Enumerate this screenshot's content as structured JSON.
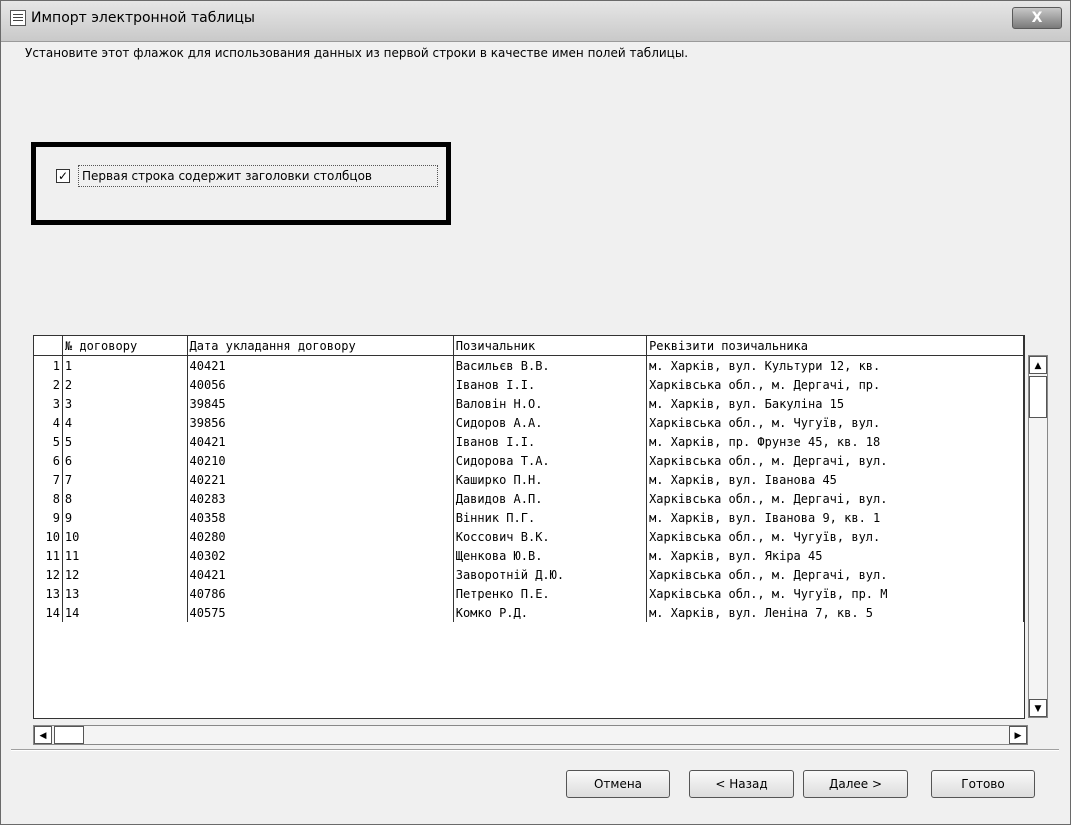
{
  "window": {
    "title": "Импорт электронной таблицы",
    "close_label": "X"
  },
  "hint": "Установите этот флажок для использования данных из первой строки в качестве имен полей таблицы.",
  "checkbox": {
    "label": "Первая строка содержит заголовки столбцов",
    "checked": true,
    "mark": "✓"
  },
  "table": {
    "columns": [
      "№ договору",
      "Дата укладання договору",
      "Позичальник",
      "Реквізити позичальника"
    ],
    "rows": [
      {
        "n": "1",
        "c": [
          "1",
          "40421",
          "Васильєв В.В.",
          "м. Харків, вул. Культури 12, кв."
        ]
      },
      {
        "n": "2",
        "c": [
          "2",
          "40056",
          "Іванов І.І.",
          "Харківська обл., м. Дергачі, пр."
        ]
      },
      {
        "n": "3",
        "c": [
          "3",
          "39845",
          "Валовін Н.О.",
          "м. Харків, вул. Бакуліна 15"
        ]
      },
      {
        "n": "4",
        "c": [
          "4",
          "39856",
          "Сидоров А.А.",
          "Харківська обл., м. Чугуїв, вул."
        ]
      },
      {
        "n": "5",
        "c": [
          "5",
          "40421",
          "Іванов І.І.",
          "м. Харків, пр. Фрунзе 45, кв. 18"
        ]
      },
      {
        "n": "6",
        "c": [
          "6",
          "40210",
          "Сидорова Т.А.",
          "Харківська обл., м. Дергачі, вул."
        ]
      },
      {
        "n": "7",
        "c": [
          "7",
          "40221",
          "Каширко П.Н.",
          "м. Харків, вул. Іванова 45"
        ]
      },
      {
        "n": "8",
        "c": [
          "8",
          "40283",
          "Давидов А.П.",
          "Харківська обл., м. Дергачі, вул."
        ]
      },
      {
        "n": "9",
        "c": [
          "9",
          "40358",
          "Вінник П.Г.",
          "м. Харків, вул. Іванова 9, кв. 1"
        ]
      },
      {
        "n": "10",
        "c": [
          "10",
          "40280",
          "Коссович В.К.",
          "Харківська обл., м. Чугуїв, вул."
        ]
      },
      {
        "n": "11",
        "c": [
          "11",
          "40302",
          "Щенкова Ю.В.",
          "м. Харків, вул. Якіра 45"
        ]
      },
      {
        "n": "12",
        "c": [
          "12",
          "40421",
          "Заворотній Д.Ю.",
          "Харківська обл., м. Дергачі, вул."
        ]
      },
      {
        "n": "13",
        "c": [
          "13",
          "40786",
          "Петренко П.Е.",
          "Харківська обл., м. Чугуїв, пр. М"
        ]
      },
      {
        "n": "14",
        "c": [
          "14",
          "40575",
          "Комко Р.Д.",
          "м. Харків, вул. Леніна 7, кв. 5"
        ]
      }
    ]
  },
  "buttons": {
    "cancel": "Отмена",
    "back": "< Назад",
    "next": "Далее >",
    "finish": "Готово"
  },
  "scroll": {
    "up": "▲",
    "down": "▼",
    "left": "◀",
    "right": "▶"
  }
}
